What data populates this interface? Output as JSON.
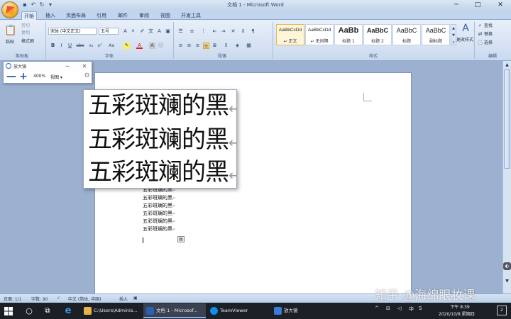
{
  "window": {
    "title": "文档 1 - Microsoft Word",
    "controls": {
      "minimize": "─",
      "maximize": "□",
      "close": "✕"
    }
  },
  "quick_access": [
    "save-icon",
    "undo-icon",
    "redo-icon",
    "customize-icon"
  ],
  "tabs": [
    {
      "label": "开始",
      "active": true
    },
    {
      "label": "插入"
    },
    {
      "label": "页面布局"
    },
    {
      "label": "引用"
    },
    {
      "label": "邮件"
    },
    {
      "label": "审阅"
    },
    {
      "label": "视图"
    },
    {
      "label": "开发工具"
    }
  ],
  "ribbon": {
    "clipboard": {
      "label": "剪贴板",
      "paste": "粘贴",
      "cut": "剪切",
      "copy": "复制",
      "format_painter": "格式刷"
    },
    "font": {
      "label": "字体",
      "font_name": "宋体 (中文正文)",
      "font_size": "五号",
      "buttons": [
        "B",
        "I",
        "U",
        "abe",
        "x₂",
        "x²",
        "Aa",
        "A"
      ]
    },
    "paragraph": {
      "label": "段落"
    },
    "styles": {
      "label": "样式",
      "items": [
        {
          "sample": "AaBbCcDd",
          "name": "↵ 正文",
          "selected": true
        },
        {
          "sample": "AaBbCcDd",
          "name": "↵ 无间隔"
        },
        {
          "sample": "AaBb",
          "name": "标题 1"
        },
        {
          "sample": "AaBbC",
          "name": "标题 2"
        },
        {
          "sample": "AaBbC",
          "name": "标题"
        },
        {
          "sample": "AaBbC",
          "name": "副标题"
        }
      ],
      "change_styles": "更改样式"
    },
    "editing": {
      "label": "编辑",
      "find": "查找",
      "replace": "替换",
      "select": "选择"
    }
  },
  "magnifier": {
    "title": "放大镜",
    "zoom": "400%",
    "view_menu": "视图 ▾",
    "minus": "—",
    "plus": "+"
  },
  "lens": {
    "lines": [
      "五彩斑斓的黑",
      "五彩斑斓的黑",
      "五彩斑斓的黑"
    ],
    "mark": "↵"
  },
  "document": {
    "lines": [
      "五彩斑斓的黑",
      "五彩斑斓的黑",
      "五彩斑斓的黑",
      "五彩斑斓的黑",
      "五彩斑斓的黑",
      "五彩斑斓的黑"
    ],
    "mark": "↵"
  },
  "statusbar": {
    "page": "页面: 1/1",
    "words": "字数: 90",
    "language": "中文 (简体, 中国)",
    "mode": "插入"
  },
  "taskbar": {
    "apps": [
      {
        "label": "C:\\Users\\Adminis...",
        "color": "#e8b34a"
      },
      {
        "label": "文档 1 - Microsof...",
        "color": "#2b5fb4",
        "active": true
      },
      {
        "label": "TeamViewer",
        "color": "#0e8ee9"
      },
      {
        "label": "放大镜",
        "color": "#3a7bd5"
      }
    ],
    "time": "下午 8:39",
    "date": "2020/10/8 星期四",
    "ime": "中",
    "notify_count": "2"
  },
  "watermark": "知乎 @海绵眼妆课"
}
